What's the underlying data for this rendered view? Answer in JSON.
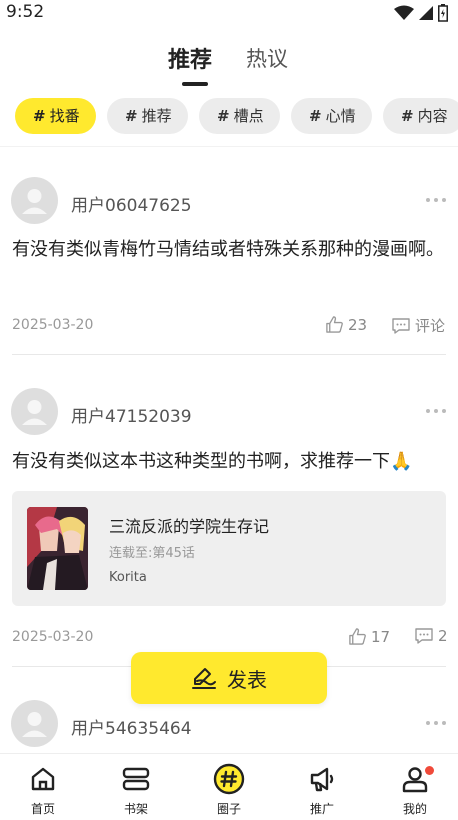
{
  "status_bar": {
    "time": "9:52"
  },
  "header": {
    "tabs": [
      {
        "label": "推荐",
        "active": true
      },
      {
        "label": "热议",
        "active": false
      }
    ]
  },
  "chips": [
    {
      "label": "找番",
      "active": true
    },
    {
      "label": "推荐",
      "active": false
    },
    {
      "label": "槽点",
      "active": false
    },
    {
      "label": "心情",
      "active": false
    },
    {
      "label": "内容",
      "active": false
    }
  ],
  "posts": [
    {
      "username": "用户06047625",
      "content": "有没有类似青梅竹马情结或者特殊关系那种的漫画啊。",
      "date": "2025-03-20",
      "likes": "23",
      "comments": "评论"
    },
    {
      "username": "用户47152039",
      "content": "有没有类似这本书这种类型的书啊，求推荐一下🙏",
      "book": {
        "title": "三流反派的学院生存记",
        "progress": "连载至:第45话",
        "author": "Korita"
      },
      "date": "2025-03-20",
      "likes": "17",
      "comments": "2"
    },
    {
      "username": "用户54635464"
    }
  ],
  "publish_button": {
    "label": "发表"
  },
  "bottom_nav": [
    {
      "label": "首页",
      "icon": "home-icon"
    },
    {
      "label": "书架",
      "icon": "bookshelf-icon"
    },
    {
      "label": "圈子",
      "icon": "circle-hash-icon",
      "active": true
    },
    {
      "label": "推广",
      "icon": "megaphone-icon"
    },
    {
      "label": "我的",
      "icon": "profile-icon",
      "badge": true
    }
  ],
  "colors": {
    "accent": "#ffe92e",
    "badge": "#f04a3a"
  }
}
